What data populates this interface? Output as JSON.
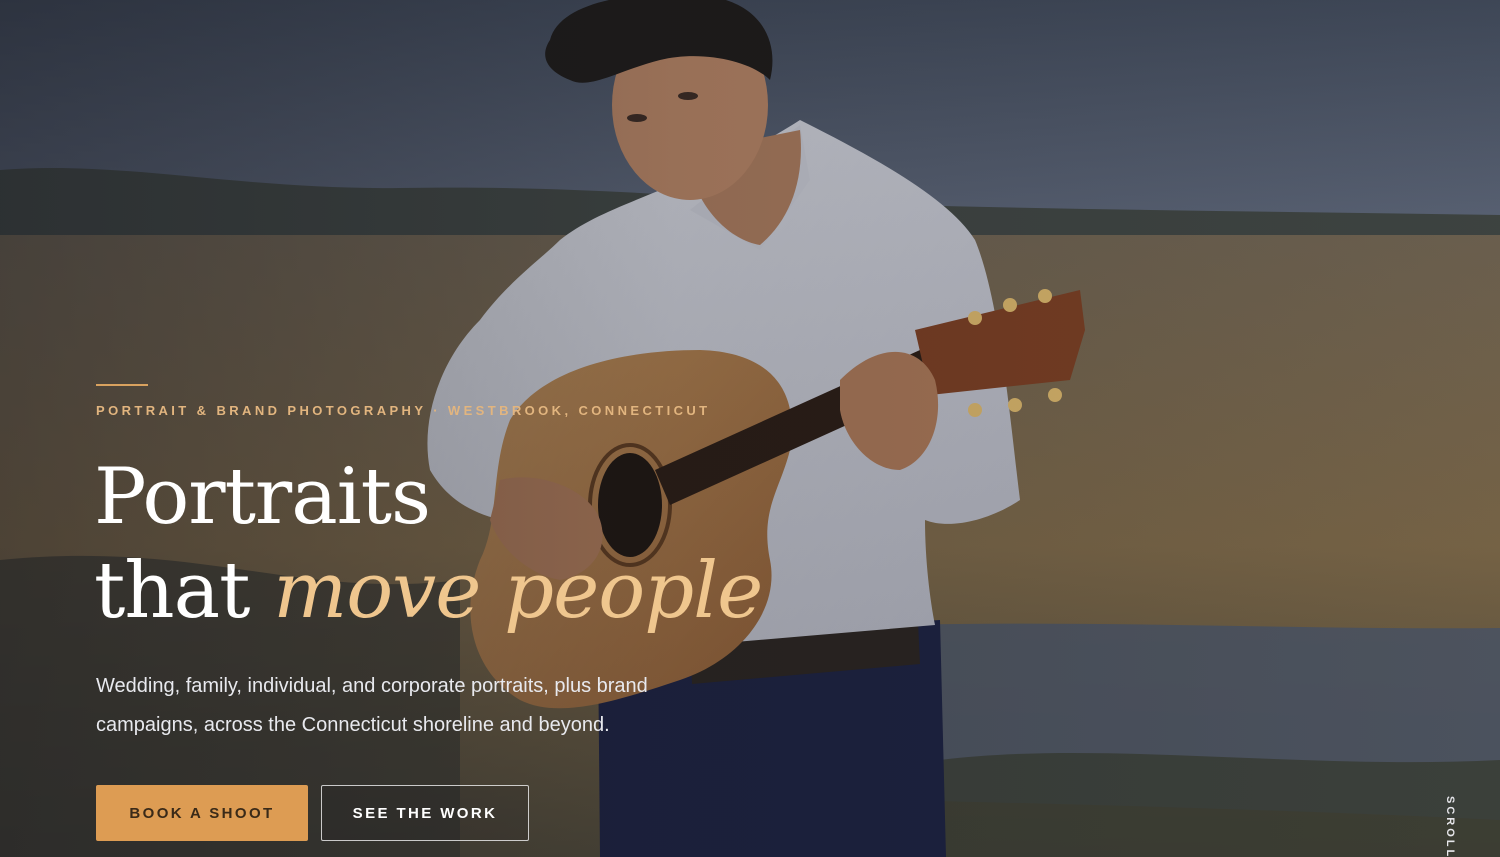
{
  "hero": {
    "eyebrow": "PORTRAIT & BRAND PHOTOGRAPHY · WESTBROOK, CONNECTICUT",
    "headline_line1": "Portraits",
    "headline_line2_plain": "that ",
    "headline_line2_accent": "move people",
    "lede": "Wedding, family, individual, and corporate portraits, plus brand campaigns, across the Connecticut shoreline and beyond.",
    "primary_cta": "BOOK A SHOOT",
    "secondary_cta": "SEE THE WORK",
    "scroll_hint": "SCROLL"
  },
  "colors": {
    "accent": "#dd9c53",
    "accent_text": "#efc68e",
    "eyebrow": "#e2b57f",
    "sky": "#4c5567",
    "field": "#6e5d45",
    "water": "#4d5565"
  },
  "icons": []
}
